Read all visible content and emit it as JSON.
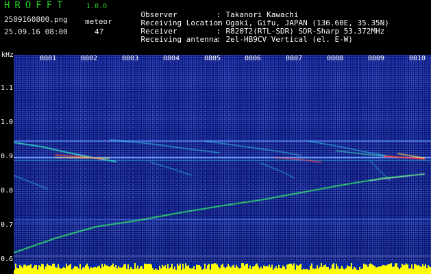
{
  "app": {
    "name": "HROFFT",
    "version": "1.0.0",
    "file_name": "2509160800.png",
    "timestamp": "25.09.16 08:00"
  },
  "meteor": {
    "label": "meteor",
    "count": "47"
  },
  "info": [
    {
      "key": "Observer",
      "sep": ":",
      "value": "Takanori Kawachi"
    },
    {
      "key": "Receiving Location",
      "sep": ":",
      "value": "Ogaki, Gifu, JAPAN (136.60E, 35.35N)"
    },
    {
      "key": "Receiver",
      "sep": ":",
      "value": "R820T2(RTL-SDR) SDR-Sharp 53.372MHz"
    },
    {
      "key": "Receiving antenna",
      "sep": ":",
      "value": "2el-HB9CV Vertical (el. E-W)"
    }
  ],
  "axis": {
    "unit": "kHz",
    "y_ticks": [
      "1.1",
      "1.0",
      "0.9",
      "0.8",
      "0.7",
      "0.6"
    ],
    "x_ticks": [
      "0801",
      "0802",
      "0803",
      "0804",
      "0805",
      "0806",
      "0807",
      "0808",
      "0809",
      "0810"
    ]
  },
  "colors": {
    "title": "#22d022",
    "background": "#06106a",
    "signal": "#33ff66",
    "hot": "#ff3030",
    "strip": "#ffff00"
  }
}
